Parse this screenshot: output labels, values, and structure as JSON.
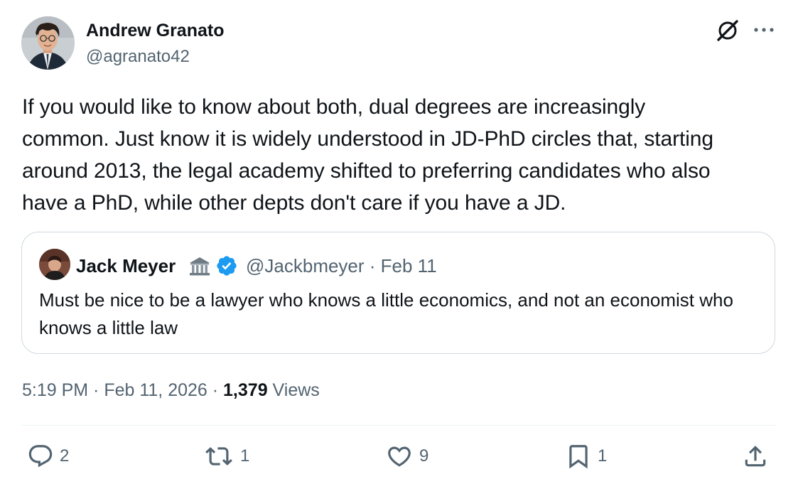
{
  "tweet": {
    "author": {
      "name": "Andrew Granato",
      "handle": "@agranato42"
    },
    "text": "If you would like to know about both, dual degrees are increasingly\ncommon. Just know it is widely understood in JD-PhD circles that, starting\naround 2013, the legal academy shifted to preferring candidates who also\nhave a PhD, while other depts don't care if you have a JD.",
    "quote": {
      "name": "Jack Meyer",
      "name_emoji": "🏛️",
      "verified": true,
      "handle_and_date": "@Jackbmeyer · Feb 11",
      "text": "Must be nice to be a lawyer who knows a little economics, and not an economist who knows a little law"
    },
    "meta": {
      "time_date": "5:19 PM · Feb 11, 2026 · ",
      "views_count": "1,379",
      "views_label": " Views"
    },
    "actions": {
      "replies": "2",
      "reposts": "1",
      "likes": "9",
      "bookmarks": "1"
    }
  },
  "icons": {
    "header_right": [
      "grok-icon",
      "more-icon"
    ],
    "actions": [
      "reply-icon",
      "repost-icon",
      "like-icon",
      "bookmark-icon",
      "share-icon"
    ]
  },
  "colors": {
    "text_primary": "#0f1419",
    "text_secondary": "#536471",
    "border": "#cfd9de",
    "verified_blue": "#1d9bf0"
  }
}
